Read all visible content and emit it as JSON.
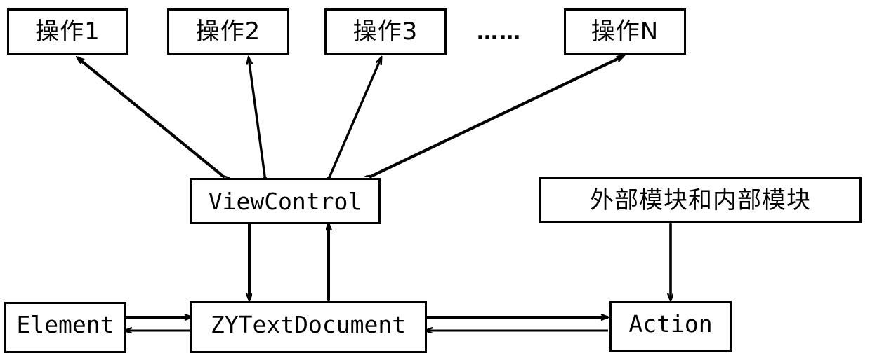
{
  "diagram": {
    "title": "ViewControl architecture diagram",
    "background_color": "#ffffff",
    "stroke_color": "#000000",
    "nodes": {
      "operation1": {
        "label": "操作1"
      },
      "operation2": {
        "label": "操作2"
      },
      "operation3": {
        "label": "操作3"
      },
      "operation_ellipsis": {
        "label": "……"
      },
      "operationN": {
        "label": "操作N"
      },
      "view_control": {
        "label": "ViewControl"
      },
      "external_internal_modules": {
        "label": "外部模块和内部模块"
      },
      "element": {
        "label": "Element"
      },
      "zy_text_document": {
        "label": "ZYTextDocument"
      },
      "action": {
        "label": "Action"
      }
    },
    "edges": [
      {
        "from": "view_control",
        "to": "operation1",
        "kind": "bidirectional"
      },
      {
        "from": "view_control",
        "to": "operation2",
        "kind": "bidirectional"
      },
      {
        "from": "view_control",
        "to": "operation3",
        "kind": "bidirectional"
      },
      {
        "from": "view_control",
        "to": "operationN",
        "kind": "bidirectional"
      },
      {
        "from": "view_control",
        "to": "zy_text_document",
        "kind": "down"
      },
      {
        "from": "zy_text_document",
        "to": "view_control",
        "kind": "bidirectional"
      },
      {
        "from": "element",
        "to": "zy_text_document",
        "kind": "right"
      },
      {
        "from": "zy_text_document",
        "to": "element",
        "kind": "left"
      },
      {
        "from": "zy_text_document",
        "to": "action",
        "kind": "right"
      },
      {
        "from": "action",
        "to": "zy_text_document",
        "kind": "left"
      },
      {
        "from": "external_internal_modules",
        "to": "action",
        "kind": "bidirectional"
      }
    ]
  }
}
